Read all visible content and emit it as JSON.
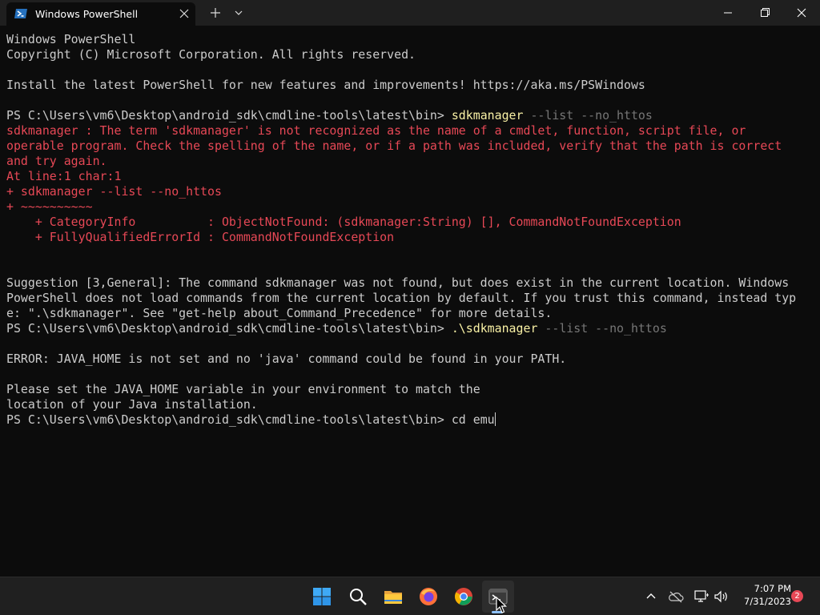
{
  "window": {
    "tab_title": "Windows PowerShell",
    "tab_icon": "powershell-icon",
    "new_tab_icon": "plus-icon",
    "dropdown_icon": "chevron-down-icon"
  },
  "terminal": {
    "prompt": "PS C:\\Users\\vm6\\Desktop\\android_sdk\\cmdline-tools\\latest\\bin> ",
    "l1": "Windows PowerShell",
    "l2": "Copyright (C) Microsoft Corporation. All rights reserved.",
    "l3": "Install the latest PowerShell for new features and improvements! https://aka.ms/PSWindows",
    "cmd1_name": "sdkmanager",
    "cmd1_args": " --list --no_httos",
    "err1": "sdkmanager : The term 'sdkmanager' is not recognized as the name of a cmdlet, function, script file, or",
    "err2": "operable program. Check the spelling of the name, or if a path was included, verify that the path is correct",
    "err3": "and try again.",
    "err4": "At line:1 char:1",
    "err5": "+ sdkmanager --list --no_httos",
    "err6": "+ ~~~~~~~~~~",
    "err7": "    + CategoryInfo          : ObjectNotFound: (sdkmanager:String) [], CommandNotFoundException",
    "err8": "    + FullyQualifiedErrorId : CommandNotFoundException",
    "sug1": "Suggestion [3,General]: The command sdkmanager was not found, but does exist in the current location. Windows",
    "sug2": "PowerShell does not load commands from the current location by default. If you trust this command, instead typ",
    "sug3": "e: \".\\sdkmanager\". See \"get-help about_Command_Precedence\" for more details.",
    "cmd2_name": ".\\sdkmanager",
    "cmd2_args": " --list --no_httos",
    "java1": "ERROR: JAVA_HOME is not set and no 'java' command could be found in your PATH.",
    "java2": "Please set the JAVA_HOME variable in your environment to match the",
    "java3": "location of your Java installation.",
    "cmd3": "cd emu"
  },
  "taskbar": {
    "apps": [
      "windows-start-icon",
      "search-icon",
      "file-explorer-icon",
      "firefox-icon",
      "chrome-icon",
      "terminal-icon"
    ],
    "tray_icons": [
      "chevron-up-icon",
      "onedrive-icon",
      "network-icon",
      "volume-icon"
    ],
    "time": "7:07 PM",
    "date": "7/31/2023",
    "notification_count": "2"
  },
  "colors": {
    "background": "#0c0c0c",
    "text": "#cccccc",
    "error": "#e74856",
    "command": "#f9f1a5",
    "argument": "#767676",
    "taskbar": "#202020"
  }
}
